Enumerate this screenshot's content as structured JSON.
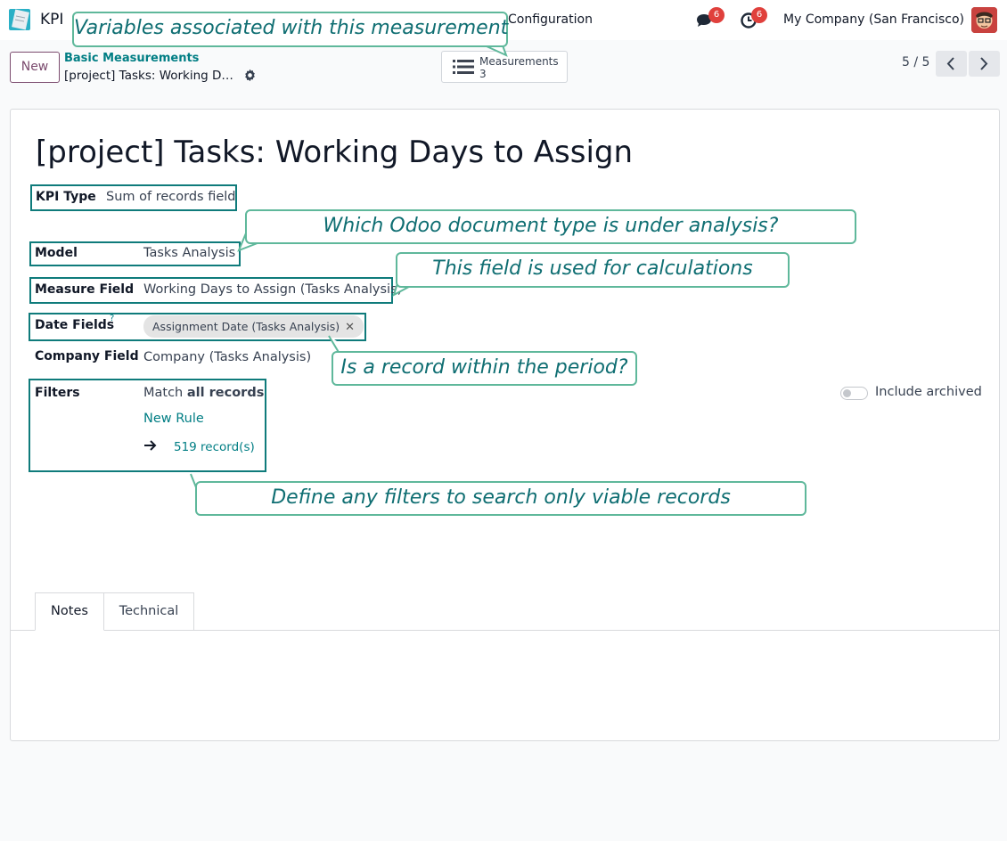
{
  "nav": {
    "app_name": "KPI",
    "menu_configuration": "Configuration",
    "messages_count": "6",
    "activities_count": "6",
    "company": "My Company (San Francisco)"
  },
  "control": {
    "new_label": "New",
    "breadcrumb_parent": "Basic Measurements",
    "breadcrumb_current": "[project] Tasks: Working D…",
    "smart_label": "Measurements",
    "smart_value": "3",
    "pager": "5 / 5"
  },
  "record": {
    "title": "[project] Tasks: Working Days to Assign",
    "kpi_type_label": "KPI Type",
    "kpi_type_value": "Sum of records field",
    "model_label": "Model",
    "model_value": "Tasks Analysis",
    "measure_label": "Measure Field",
    "measure_value": "Working Days to Assign (Tasks Analysis)",
    "date_label": "Date Fields",
    "date_help": "?",
    "date_tag": "Assignment Date (Tasks Analysis)",
    "company_label": "Company Field",
    "company_value": "Company (Tasks Analysis)",
    "filters_label": "Filters",
    "filters_match_prefix": "Match ",
    "filters_match_bold": "all records",
    "new_rule": "New Rule",
    "record_count": "519 record(s)",
    "include_archived": "Include archived"
  },
  "tabs": [
    {
      "label": "Notes",
      "active": true
    },
    {
      "label": "Technical",
      "active": false
    }
  ],
  "callouts": {
    "variables": "Variables associated with this measurement",
    "model": "Which Odoo document type is under analysis?",
    "measure": "This field is used for calculations",
    "period": "Is a record within the period?",
    "filters": "Define any filters to search only viable records"
  },
  "colors": {
    "brand": "#7b4b6e",
    "link": "#017e84",
    "highlight": "#0f7b7b",
    "callout_border": "#5fb89b",
    "badge": "#e0403c"
  },
  "icons": [
    "kpi-app-icon",
    "chat-icon",
    "clock-icon",
    "gear-icon",
    "list-icon",
    "chevron-left-icon",
    "chevron-right-icon",
    "arrow-right-icon",
    "close-icon"
  ]
}
